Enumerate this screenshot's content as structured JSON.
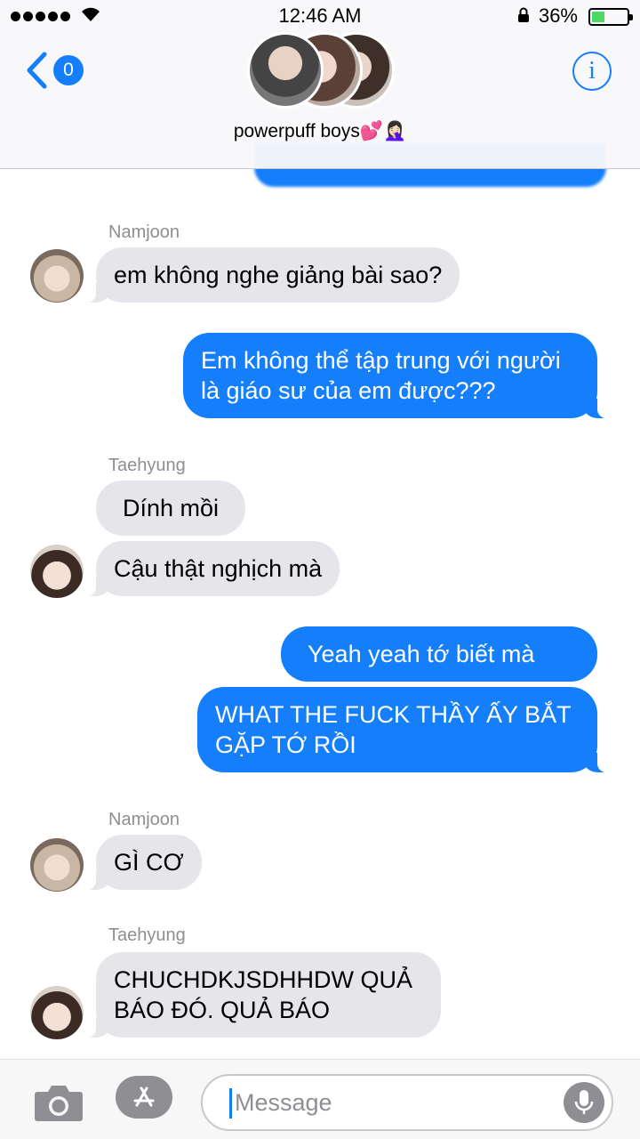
{
  "status_bar": {
    "time": "12:46 AM",
    "battery_percent": "36%",
    "battery_level": 0.36,
    "signal_icon": "signal-dots-icon",
    "wifi_icon": "wifi-icon"
  },
  "header": {
    "back_badge": "0",
    "group_name": "powerpuff boys💕🤦🏻‍♀️",
    "info_label": "i"
  },
  "messages": [
    {
      "sender": "Namjoon",
      "text": "em không nghe giảng bài sao?",
      "direction": "incoming"
    },
    {
      "text": "Em không thể tập trung với người là giáo sư của em được???",
      "direction": "outgoing"
    },
    {
      "sender": "Taehyung",
      "text": "Dính mồi",
      "direction": "incoming"
    },
    {
      "text": "Cậu thật nghịch mà",
      "direction": "incoming"
    },
    {
      "text": "Yeah yeah tớ biết mà",
      "direction": "outgoing"
    },
    {
      "text": "WHAT THE FUCK THẦY ẤY BẮT GẶP TỚ RỒI",
      "direction": "outgoing"
    },
    {
      "sender": "Namjoon",
      "text": "GÌ CƠ",
      "direction": "incoming"
    },
    {
      "sender": "Taehyung",
      "text": "CHUCHDKJSDHHDW QUẢ BÁO ĐÓ. QUẢ BÁO",
      "direction": "incoming"
    }
  ],
  "input": {
    "placeholder": "Message"
  },
  "colors": {
    "accent": "#147efb",
    "incoming_bubble": "#e5e5ea",
    "sender_text": "#8e8e93"
  }
}
